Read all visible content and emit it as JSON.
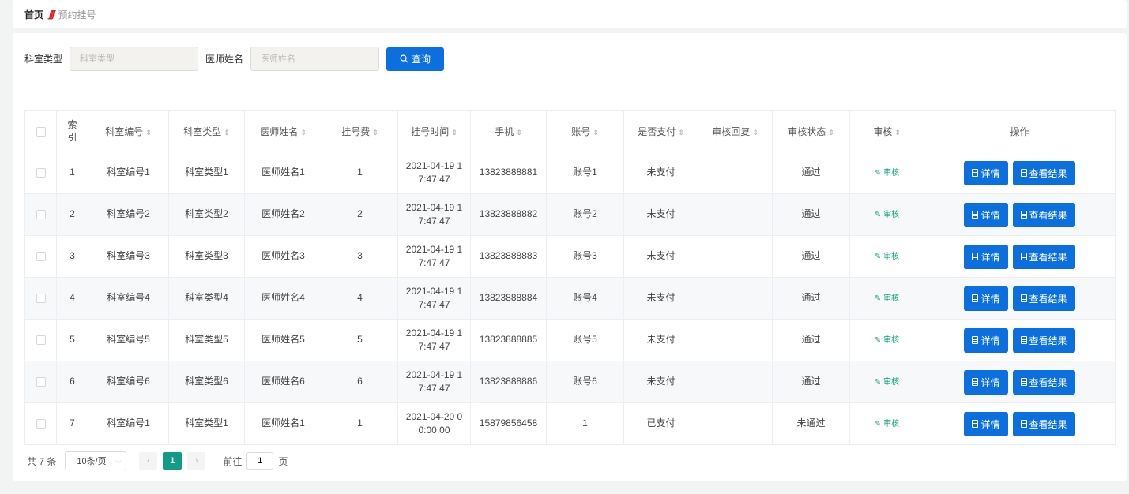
{
  "breadcrumb": {
    "home": "首页",
    "separator": "ʃʃʃ",
    "current": "预约挂号"
  },
  "search": {
    "dept_type_label": "科室类型",
    "dept_type_placeholder": "科室类型",
    "doctor_label": "医师姓名",
    "doctor_placeholder": "医师姓名",
    "button_label": "查询"
  },
  "table": {
    "headers": [
      "索引",
      "科室编号",
      "科室类型",
      "医师姓名",
      "挂号费",
      "挂号时间",
      "手机",
      "账号",
      "是否支付",
      "审核回复",
      "审核状态",
      "审核",
      "操作"
    ],
    "rows": [
      {
        "index": "1",
        "dept_no": "科室编号1",
        "dept_type": "科室类型1",
        "doctor": "医师姓名1",
        "fee": "1",
        "time1": "2021-04-19 1",
        "time2": "7:47:47",
        "phone": "13823888881",
        "account": "账号1",
        "paid": "未支付",
        "reply": "",
        "status": "通过",
        "audit": "审核",
        "detail": "详情",
        "result": "查看结果"
      },
      {
        "index": "2",
        "dept_no": "科室编号2",
        "dept_type": "科室类型2",
        "doctor": "医师姓名2",
        "fee": "2",
        "time1": "2021-04-19 1",
        "time2": "7:47:47",
        "phone": "13823888882",
        "account": "账号2",
        "paid": "未支付",
        "reply": "",
        "status": "通过",
        "audit": "审核",
        "detail": "详情",
        "result": "查看结果"
      },
      {
        "index": "3",
        "dept_no": "科室编号3",
        "dept_type": "科室类型3",
        "doctor": "医师姓名3",
        "fee": "3",
        "time1": "2021-04-19 1",
        "time2": "7:47:47",
        "phone": "13823888883",
        "account": "账号3",
        "paid": "未支付",
        "reply": "",
        "status": "通过",
        "audit": "审核",
        "detail": "详情",
        "result": "查看结果"
      },
      {
        "index": "4",
        "dept_no": "科室编号4",
        "dept_type": "科室类型4",
        "doctor": "医师姓名4",
        "fee": "4",
        "time1": "2021-04-19 1",
        "time2": "7:47:47",
        "phone": "13823888884",
        "account": "账号4",
        "paid": "未支付",
        "reply": "",
        "status": "通过",
        "audit": "审核",
        "detail": "详情",
        "result": "查看结果"
      },
      {
        "index": "5",
        "dept_no": "科室编号5",
        "dept_type": "科室类型5",
        "doctor": "医师姓名5",
        "fee": "5",
        "time1": "2021-04-19 1",
        "time2": "7:47:47",
        "phone": "13823888885",
        "account": "账号5",
        "paid": "未支付",
        "reply": "",
        "status": "通过",
        "audit": "审核",
        "detail": "详情",
        "result": "查看结果"
      },
      {
        "index": "6",
        "dept_no": "科室编号6",
        "dept_type": "科室类型6",
        "doctor": "医师姓名6",
        "fee": "6",
        "time1": "2021-04-19 1",
        "time2": "7:47:47",
        "phone": "13823888886",
        "account": "账号6",
        "paid": "未支付",
        "reply": "",
        "status": "通过",
        "audit": "审核",
        "detail": "详情",
        "result": "查看结果"
      },
      {
        "index": "7",
        "dept_no": "科室编号1",
        "dept_type": "科室类型1",
        "doctor": "医师姓名1",
        "fee": "1",
        "time1": "2021-04-20 0",
        "time2": "0:00:00",
        "phone": "15879856458",
        "account": "1",
        "paid": "已支付",
        "reply": "",
        "status": "未通过",
        "audit": "审核",
        "detail": "详情",
        "result": "查看结果"
      }
    ]
  },
  "pagination": {
    "total": "共 7 条",
    "page_size": "10条/页",
    "prev": "‹",
    "current_page": "1",
    "next": "›",
    "goto_label": "前往",
    "goto_value": "1",
    "page_unit": "页"
  },
  "icons": {
    "search": "search-icon",
    "document": "document-icon",
    "edit": "edit-icon",
    "sort": "sort-icon",
    "chevron": "chevron-down-icon"
  },
  "colors": {
    "primary": "#0b6fe0",
    "audit": "#13a57f",
    "page_active": "#119c85",
    "breadcrumb_sep": "#e02020"
  }
}
